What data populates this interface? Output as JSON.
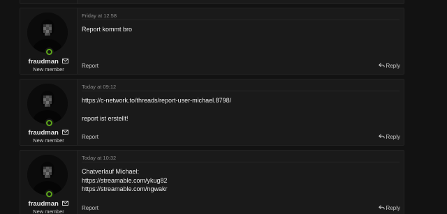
{
  "posts": [
    {
      "author": {
        "username": "fraudman",
        "title": "New member",
        "online": true
      },
      "date": "Friday at 12:58",
      "lines": [
        "Report kommt bro"
      ],
      "actions": {
        "report": "Report",
        "reply": "Reply"
      }
    },
    {
      "author": {
        "username": "fraudman",
        "title": "New member",
        "online": true
      },
      "date": "Today at 09:12",
      "lines": [
        "https://c-network.to/threads/report-user-michael.8798/",
        "",
        "report ist erstellt!"
      ],
      "actions": {
        "report": "Report",
        "reply": "Reply"
      }
    },
    {
      "author": {
        "username": "fraudman",
        "title": "New member",
        "online": true
      },
      "date": "Today at 10:32",
      "lines": [
        "Chatverlauf Michael:",
        "https://streamable.com/ykug82",
        "https://streamable.com/ngwakr"
      ],
      "actions": {
        "report": "Report",
        "reply": "Reply"
      }
    }
  ],
  "icons": {
    "online": "online-status-icon",
    "message": "envelope-icon",
    "reply": "reply-icon",
    "avatar": "pixelated-avatar"
  },
  "colors": {
    "background": "#121212",
    "post_background": "#1a1a1a",
    "online_green": "#5da51b",
    "text": "#ececec",
    "muted": "#8a8a8a"
  }
}
